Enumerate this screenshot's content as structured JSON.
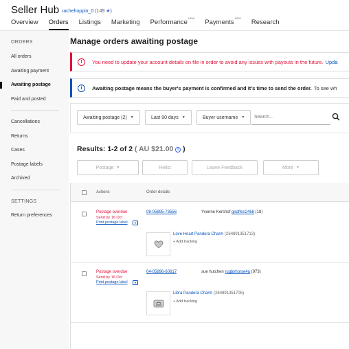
{
  "header": {
    "title": "Seller Hub",
    "username": "rachehoppin_0",
    "feedback_score": "(149",
    "star": "★",
    "score_close": ")"
  },
  "nav": {
    "tabs": [
      {
        "label": "Overview",
        "badge": ""
      },
      {
        "label": "Orders",
        "badge": ""
      },
      {
        "label": "Listings",
        "badge": ""
      },
      {
        "label": "Marketing",
        "badge": ""
      },
      {
        "label": "Performance",
        "badge": "NEW"
      },
      {
        "label": "Payments",
        "badge": "NEW"
      },
      {
        "label": "Research",
        "badge": ""
      }
    ]
  },
  "sidebar": {
    "orders_heading": "ORDERS",
    "items": [
      {
        "label": "All orders"
      },
      {
        "label": "Awaiting payment"
      },
      {
        "label": "Awaiting postage"
      },
      {
        "label": "Paid and posted"
      },
      {
        "label": "Cancellations"
      },
      {
        "label": "Returns"
      },
      {
        "label": "Cases"
      },
      {
        "label": "Postage labels"
      },
      {
        "label": "Archived"
      }
    ],
    "settings_heading": "SETTINGS",
    "settings_items": [
      {
        "label": "Return preferences"
      }
    ]
  },
  "main": {
    "title": "Manage orders awaiting postage",
    "error_alert": {
      "icon": "!",
      "text": "You need to update your account details on file in order to avoid any issues with payouts in the future.",
      "link": "Upda"
    },
    "info_alert": {
      "icon": "i",
      "bold": "Awaiting postage means the buyer's payment is confirmed and it's time to send the order.",
      "text": "To see wh"
    },
    "filters": {
      "status": "Awaiting postage (2)",
      "period": "Last 90 days",
      "field": "Buyer username",
      "search_placeholder": "Search..."
    },
    "results": {
      "label": "Results: 1-2 of 2",
      "amount": "( AU $21.00",
      "info": "i",
      "close": ")"
    },
    "actions": {
      "postage": "Postage",
      "relist": "Relist",
      "leave_feedback": "Leave Feedback",
      "more": "More"
    },
    "table": {
      "col_actions": "Actions",
      "col_details": "Order details"
    },
    "orders": [
      {
        "status": "Postage overdue",
        "send_by": "Send by 16 Oct",
        "print": "Print postage label",
        "order_number": "08-05895-73556",
        "buyer_name": "Yvonne Kershof",
        "buyer_id": "giraffes2468",
        "buyer_feedback": "(18)",
        "item_title": "Love Heart Pandora Charm",
        "item_id": "(264891351713)",
        "add_tracking": "+ Add tracking"
      },
      {
        "status": "Postage overdue",
        "send_by": "Send by 16 Oct",
        "print": "Print postage label",
        "order_number": "04-05896-60617",
        "buyer_name": "sue hutchen",
        "buyer_id": "rugbyhorse4u",
        "buyer_feedback": "(973)",
        "item_title": "Libra Pandora Charm",
        "item_id": "(264891351705)",
        "add_tracking": "+ Add tracking"
      }
    ]
  },
  "colors": {
    "link": "#0654ba",
    "error": "#e0103a",
    "sidebar_bg": "#f7f7f7"
  },
  "icons": [
    "caret-down-icon",
    "search-icon",
    "info-icon",
    "error-icon",
    "star-icon"
  ]
}
